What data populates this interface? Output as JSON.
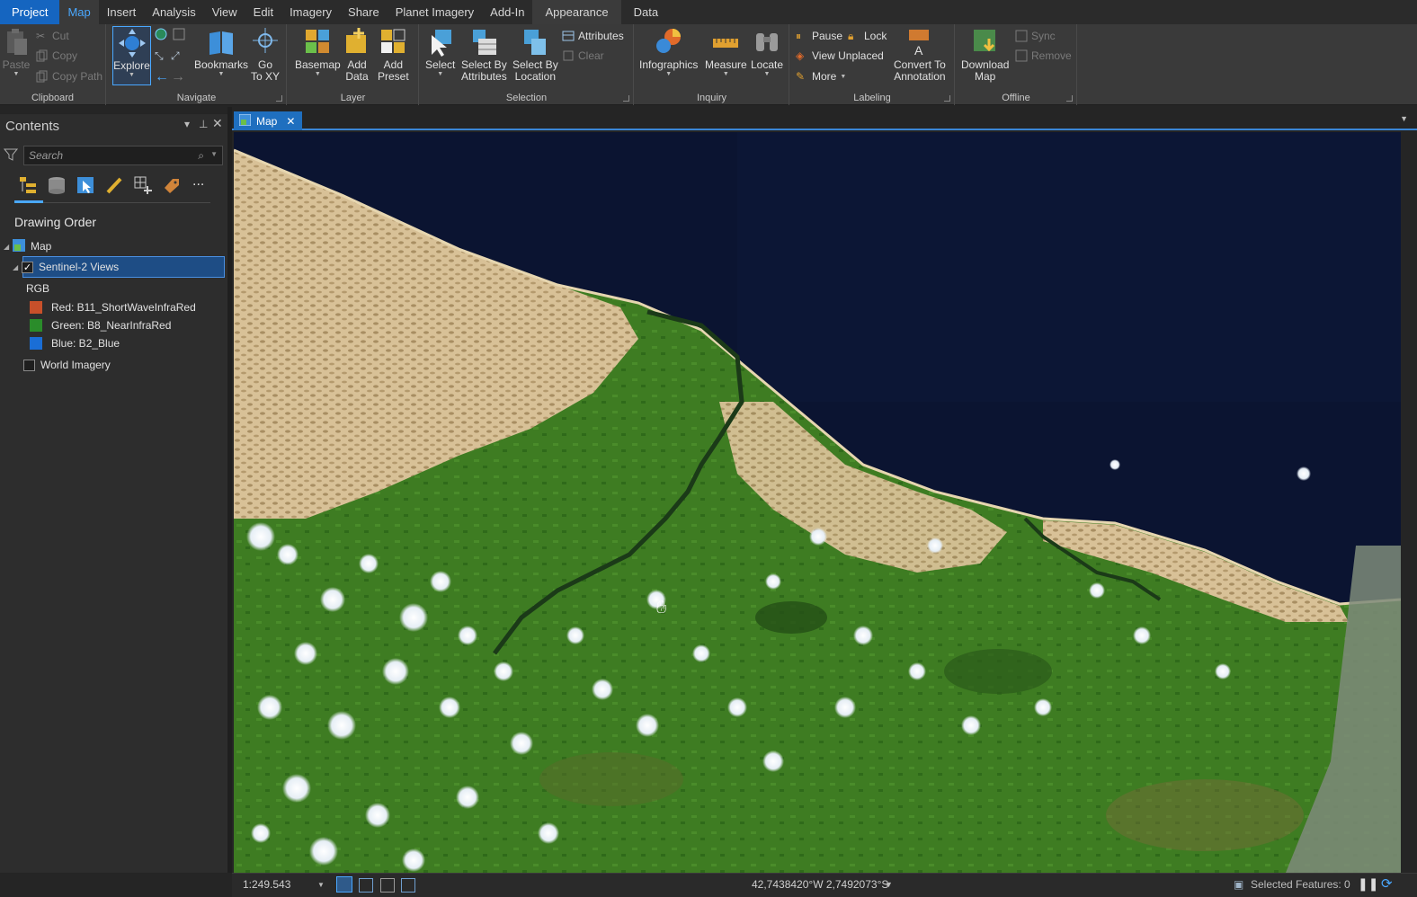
{
  "ribbon_tabs": [
    "Project",
    "Map",
    "Insert",
    "Analysis",
    "View",
    "Edit",
    "Imagery",
    "Share",
    "Planet Imagery",
    "Add-In",
    "Appearance",
    "Data"
  ],
  "ribbon": {
    "clipboard": {
      "label": "Clipboard",
      "paste": "Paste",
      "cut": "Cut",
      "copy": "Copy",
      "copy_path": "Copy Path"
    },
    "navigate": {
      "label": "Navigate",
      "explore": "Explore",
      "bookmarks": "Bookmarks",
      "go_to_xy_1": "Go",
      "go_to_xy_2": "To XY"
    },
    "layer": {
      "label": "Layer",
      "basemap": "Basemap",
      "add_data_1": "Add",
      "add_data_2": "Data",
      "add_preset_1": "Add",
      "add_preset_2": "Preset"
    },
    "selection": {
      "label": "Selection",
      "select": "Select",
      "select_by_attr_1": "Select By",
      "select_by_attr_2": "Attributes",
      "select_by_loc_1": "Select By",
      "select_by_loc_2": "Location",
      "attributes": "Attributes",
      "clear": "Clear"
    },
    "inquiry": {
      "label": "Inquiry",
      "infographics": "Infographics",
      "measure": "Measure",
      "locate": "Locate"
    },
    "labeling": {
      "label": "Labeling",
      "pause": "Pause",
      "lock": "Lock",
      "view_unplaced": "View Unplaced",
      "more": "More",
      "convert_1": "Convert To",
      "convert_2": "Annotation"
    },
    "offline": {
      "label": "Offline",
      "download_1": "Download",
      "download_2": "Map",
      "sync": "Sync",
      "remove": "Remove"
    }
  },
  "contents": {
    "title": "Contents",
    "search_placeholder": "Search",
    "section_title": "Drawing Order",
    "map_label": "Map",
    "layer_name": "Sentinel-2 Views",
    "rgb_label": "RGB",
    "bands": [
      {
        "label": "Red:  B11_ShortWaveInfraRed",
        "color": "#e0542a"
      },
      {
        "label": "Green: B8_NearInfraRed",
        "color": "#2e9e2e"
      },
      {
        "label": "Blue:  B2_Blue",
        "color": "#1e7ae0"
      }
    ],
    "world_imagery": "World Imagery",
    "more_icon": "..."
  },
  "map_tab": {
    "label": "Map"
  },
  "statusbar": {
    "scale": "1:249.543",
    "coordinates": "42,7438420°W 2,7492073°S",
    "selected_features": "Selected Features: 0"
  },
  "colors": {
    "accent": "#4aa8ff",
    "project_tab": "#1565c0",
    "ocean": "#0c1430",
    "sand": "#d9c49a",
    "vegetation": "#3f7d22"
  }
}
